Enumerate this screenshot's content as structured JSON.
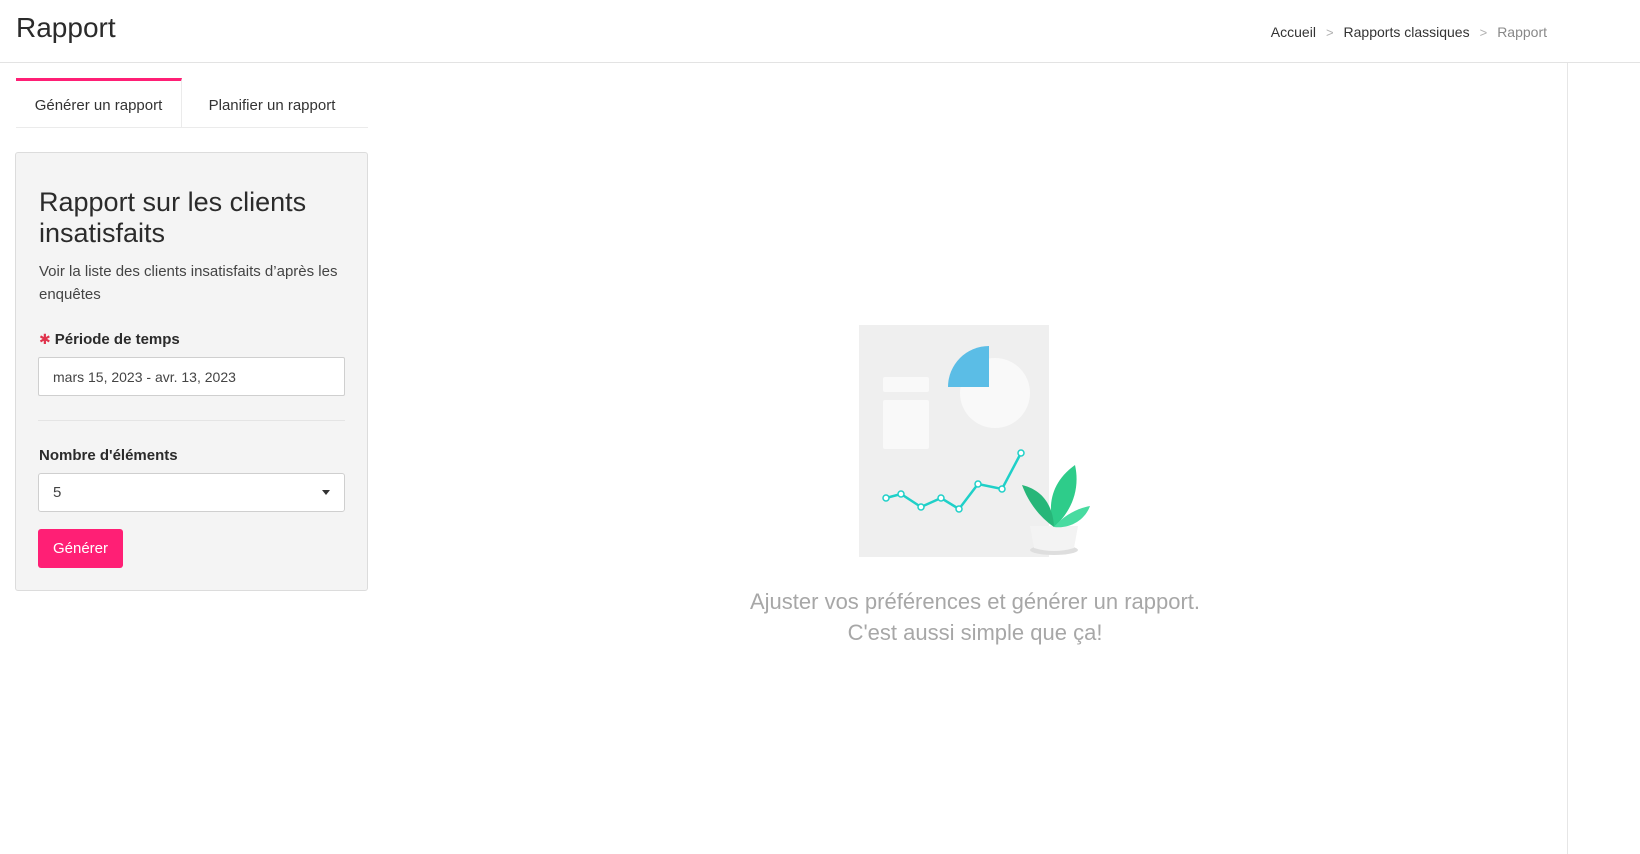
{
  "header": {
    "title": "Rapport",
    "breadcrumb": {
      "home": "Accueil",
      "section": "Rapports classiques",
      "current": "Rapport",
      "separator": ">"
    }
  },
  "tabs": [
    {
      "label": "Générer un rapport",
      "active": true
    },
    {
      "label": "Planifier un rapport",
      "active": false
    }
  ],
  "report_card": {
    "title": "Rapport sur les clients insatisfaits",
    "description": "Voir la liste des clients insatisfaits d’après les enquêtes",
    "time_period": {
      "required_marker": "✱",
      "label": "Période de temps",
      "value": "mars 15, 2023 - avr. 13, 2023"
    },
    "item_count": {
      "label": "Nombre d'éléments",
      "selected": "5"
    },
    "generate_label": "Générer"
  },
  "empty_state": {
    "line1": "Ajuster vos préférences et générer un rapport.",
    "line2": "C'est aussi simple que ça!"
  },
  "colors": {
    "accent": "#ff1f75",
    "chart_line": "#1fd0c8",
    "pie_slice": "#5bbde6",
    "leaf": "#2ecc8a"
  }
}
